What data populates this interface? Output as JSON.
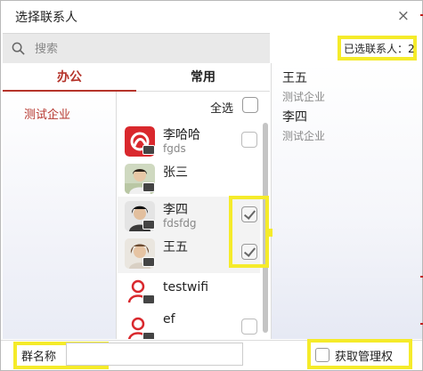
{
  "window": {
    "title": "选择联系人",
    "close_glyph": "×"
  },
  "search": {
    "placeholder": "搜索",
    "icon": "search-icon"
  },
  "selected_count": "已选联系人：2",
  "tabs": [
    {
      "label": "办公",
      "active": true
    },
    {
      "label": "常用",
      "active": false
    }
  ],
  "organizations": [
    {
      "label": "测试企业"
    }
  ],
  "contact_list": {
    "select_all_label": "全选",
    "select_all_checked": false,
    "items": [
      {
        "name": "李哈哈",
        "sub": "fgds",
        "avatar": "red-logo",
        "checked": false,
        "checkbox": true
      },
      {
        "name": "张三",
        "sub": "",
        "avatar": "photo",
        "checked": false,
        "checkbox": false
      },
      {
        "name": "李四",
        "sub": "fdsfdg",
        "avatar": "photo",
        "checked": true,
        "checkbox": true
      },
      {
        "name": "王五",
        "sub": "",
        "avatar": "photo",
        "checked": true,
        "checkbox": true
      },
      {
        "name": "testwifi",
        "sub": "",
        "avatar": "default-user",
        "checked": false,
        "checkbox": false
      },
      {
        "name": "ef",
        "sub": "",
        "avatar": "default-user",
        "checked": false,
        "checkbox": true
      }
    ]
  },
  "selected_contacts": [
    {
      "name": "王五",
      "org": "测试企业"
    },
    {
      "name": "李四",
      "org": "测试企业"
    }
  ],
  "bottom": {
    "group_name_label": "群名称",
    "group_name_value": "",
    "admin_label": "获取管理权",
    "admin_checked": false
  },
  "colors": {
    "accent": "#b5342b",
    "highlight": "#f5eb2a"
  }
}
